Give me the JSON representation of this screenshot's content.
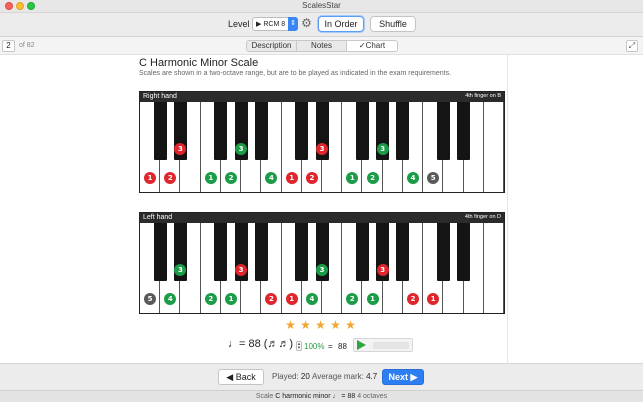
{
  "window": {
    "title": "ScalesStar"
  },
  "toolbar": {
    "level_label": "Level",
    "level_value": "RCM 8",
    "in_order_label": "In Order",
    "shuffle_label": "Shuffle"
  },
  "subbar": {
    "page_number": "2",
    "page_of": "of 82",
    "tabs": [
      "Description",
      "Notes",
      "Chart"
    ],
    "selected_tab": "Chart"
  },
  "scale": {
    "title": "C Harmonic Minor Scale",
    "subtitle": "Scales are shown in a two-octave range, but are to be played as indicated in the exam requirements."
  },
  "right_hand": {
    "label": "Right hand",
    "note": "4th finger on B",
    "fingers": [
      {
        "key": "w0",
        "n": "1",
        "color": "red"
      },
      {
        "key": "w1",
        "n": "2",
        "color": "red"
      },
      {
        "key": "b1",
        "n": "3",
        "color": "red"
      },
      {
        "key": "w3",
        "n": "1",
        "color": "green"
      },
      {
        "key": "w4",
        "n": "2",
        "color": "green"
      },
      {
        "key": "b4",
        "n": "3",
        "color": "green"
      },
      {
        "key": "w6",
        "n": "4",
        "color": "green"
      },
      {
        "key": "w7",
        "n": "1",
        "color": "red"
      },
      {
        "key": "w8",
        "n": "2",
        "color": "red"
      },
      {
        "key": "b8",
        "n": "3",
        "color": "red"
      },
      {
        "key": "w10",
        "n": "1",
        "color": "green"
      },
      {
        "key": "w11",
        "n": "2",
        "color": "green"
      },
      {
        "key": "b11",
        "n": "3",
        "color": "green"
      },
      {
        "key": "w13",
        "n": "4",
        "color": "green"
      },
      {
        "key": "w14",
        "n": "5",
        "color": "grey"
      }
    ]
  },
  "left_hand": {
    "label": "Left hand",
    "note": "4th finger on D",
    "fingers": [
      {
        "key": "w0",
        "n": "5",
        "color": "grey"
      },
      {
        "key": "w1",
        "n": "4",
        "color": "green"
      },
      {
        "key": "b1",
        "n": "3",
        "color": "green"
      },
      {
        "key": "w3",
        "n": "2",
        "color": "green"
      },
      {
        "key": "w4",
        "n": "1",
        "color": "green"
      },
      {
        "key": "b4",
        "n": "3",
        "color": "red"
      },
      {
        "key": "w6",
        "n": "2",
        "color": "red"
      },
      {
        "key": "w7",
        "n": "1",
        "color": "red"
      },
      {
        "key": "w8",
        "n": "4",
        "color": "green"
      },
      {
        "key": "b8",
        "n": "3",
        "color": "green"
      },
      {
        "key": "w10",
        "n": "2",
        "color": "green"
      },
      {
        "key": "w11",
        "n": "1",
        "color": "green"
      },
      {
        "key": "b11",
        "n": "3",
        "color": "red"
      },
      {
        "key": "w13",
        "n": "2",
        "color": "red"
      },
      {
        "key": "w14",
        "n": "1",
        "color": "red"
      }
    ]
  },
  "rating": {
    "stars": 5,
    "max": 5
  },
  "tempo": {
    "label": "♩= 88 (♬♬)",
    "percent": "100%",
    "equals": "=",
    "bpm": "88",
    "progress": 0
  },
  "bottom": {
    "back_label": "Back",
    "played_label": "Played:",
    "played_value": "20",
    "average_label": "Average mark:",
    "average_value": "4.7",
    "next_label": "Next"
  },
  "status": {
    "label": "Scale",
    "scale_name": "C harmonic minor",
    "tempo": "♩ = 88",
    "octaves": "4 octaves"
  },
  "colors": {
    "red": "#e0262d",
    "green": "#1c9c47",
    "grey": "#5a5a5a",
    "accent": "#2e7ef3",
    "star": "#f0a531"
  }
}
